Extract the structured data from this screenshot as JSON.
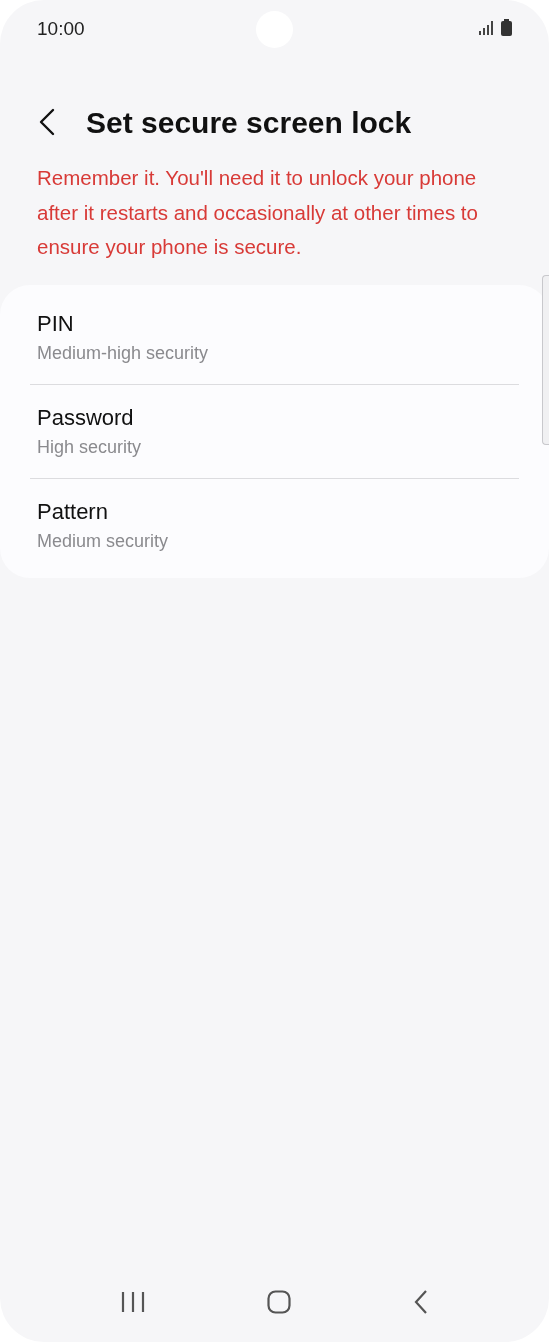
{
  "status_bar": {
    "time": "10:00"
  },
  "header": {
    "title": "Set secure screen lock"
  },
  "warning": "Remember it. You'll need it to unlock your phone after it restarts and occasionally at other times to ensure your phone is secure.",
  "options": [
    {
      "title": "PIN",
      "subtitle": "Medium-high security"
    },
    {
      "title": "Password",
      "subtitle": "High security"
    },
    {
      "title": "Pattern",
      "subtitle": "Medium security"
    }
  ]
}
